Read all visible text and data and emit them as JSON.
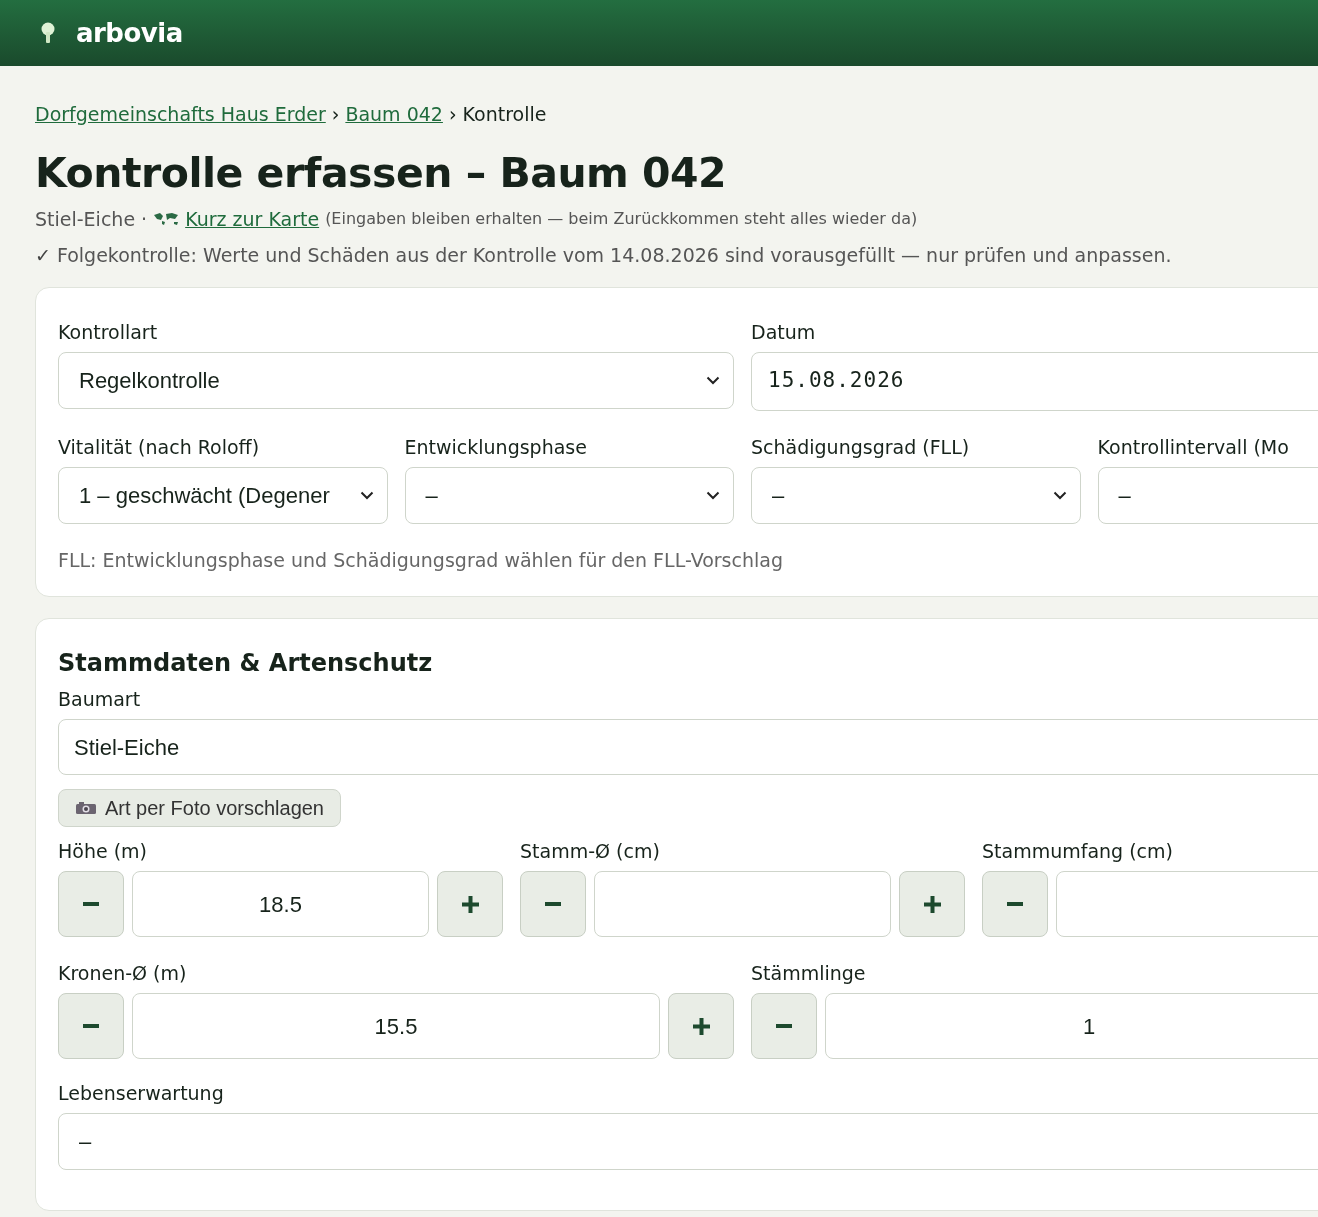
{
  "header": {
    "brand": "arbovia"
  },
  "breadcrumb": [
    {
      "label": "Dorfgemeinschafts Haus Erder",
      "kind": "link"
    },
    {
      "label": "›",
      "kind": "separator"
    },
    {
      "label": "Baum 042",
      "kind": "link"
    },
    {
      "label": "›",
      "kind": "separator"
    },
    {
      "label": "Kontrolle",
      "kind": "current"
    }
  ],
  "title": "Kontrolle erfassen – Baum 042",
  "subtitle": {
    "species": "Stiel-Eiche ·",
    "map_link": "Kurz zur Karte",
    "note": "(Eingaben bleiben erhalten — beim Zurückkommen steht alles wieder da)"
  },
  "notice": {
    "icon": "✓",
    "text": "Folgekontrolle: Werte und Schäden aus der Kontrolle vom 14.08.2026 sind vorausgefüllt — nur prüfen und anpassen."
  },
  "control_card": {
    "row_1": [
      {
        "label": "Kontrollart",
        "kind": "select",
        "value": "Regelkontrolle"
      },
      {
        "label": "Datum",
        "kind": "date",
        "value": "15.08.2026"
      }
    ],
    "row_2": [
      {
        "label": "Vitalität (nach Roloff)",
        "kind": "select",
        "value": "1 – geschwächt (Degener"
      },
      {
        "label": "Entwicklungsphase",
        "kind": "select",
        "value": "–"
      },
      {
        "label": "Schädigungsgrad (FLL)",
        "kind": "select",
        "value": "–"
      },
      {
        "label": "Kontrollintervall (Mo",
        "kind": "select_cut",
        "value": "–"
      }
    ],
    "hint": "FLL: Entwicklungsphase und Schädigungsgrad wählen für den FLL-Vorschlag"
  },
  "master_card": {
    "heading": "Stammdaten & Artenschutz",
    "species_field": {
      "label": "Baumart",
      "value": "Stiel-Eiche"
    },
    "photo_button": "Art per Foto vorschlagen",
    "stepper_row_1": [
      {
        "label": "Höhe (m)",
        "value": "18.5"
      },
      {
        "label": "Stamm-Ø (cm)"
      },
      {
        "label": "Stammumfang (cm)"
      }
    ],
    "stepper_row_2": [
      {
        "label": "Kronen-Ø (m)",
        "value": "15.5"
      },
      {
        "label": "Stämmlinge",
        "value": "1"
      }
    ],
    "life_expectancy": {
      "label": "Lebenserwartung",
      "value": "–"
    }
  }
}
